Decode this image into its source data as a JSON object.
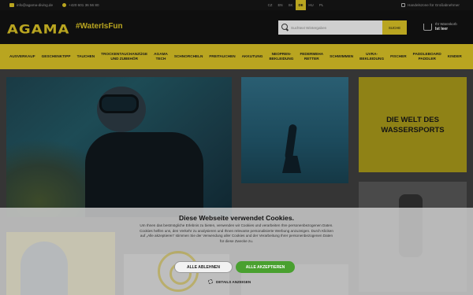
{
  "topbar": {
    "email": "info@agama-diving.de",
    "phone": "+420 601 36 56 80",
    "languages": [
      "CZ",
      "EN",
      "SK",
      "DE",
      "HU",
      "PL"
    ],
    "active_language": "DE",
    "secure": "Handelszone für Großabnehmer"
  },
  "header": {
    "logo": "AGAMA",
    "slogan": "#WaterIsFun",
    "search_placeholder": "Suchtext Wintergaben",
    "search_button": "SUCHE",
    "cart_label": "Ihr Warenkorb",
    "cart_value": "Ist leer"
  },
  "nav": {
    "items": [
      "AUSVERKAUF",
      "GESCHENKTIPP",
      "TAUCHEN",
      "TROCKENTAUCHANZÜGE\nUND ZUBEHÖR",
      "AGAMA\nTECH",
      "SCHNORCHELN",
      "FREITAUCHEN",
      "AKKUTUNG",
      "NEOPREN-\nBEKLEIDUNG",
      "FEDERMEHA\nRETTER",
      "SCHWIMMEN",
      "UVRA-\nBEKLEIDUNG",
      "FISCHER",
      "PADDLEBOARD\nPADDLER",
      "KINDER"
    ]
  },
  "main": {
    "promo_title": "DIE WELT DES\nWASSERSPORTS"
  },
  "cookie": {
    "title": "Diese Webseite verwendet Cookies.",
    "body": "Um Ihnen das bestmögliche Erlebnis zu bieten, verwenden wir Cookies und verarbeiten Ihre personenbezogenen Daten. Cookies helfen uns, den Verkehr zu analysieren und Ihnen relevante personalisierte Werbung anzuzeigen. Durch Klicken auf „Alle akzeptieren“ stimmen Sie der Verwendung aller Cookies und der Verarbeitung Ihrer personenbezogenen Daten für diese Zwecke zu.",
    "decline_label": "ALLE ABLEHNEN",
    "accept_label": "ALLE AKZEPTIEREN",
    "details_label": "DETAILS ANZEIGEN"
  },
  "colors": {
    "accent": "#b9a520",
    "accept": "#49a02f"
  }
}
